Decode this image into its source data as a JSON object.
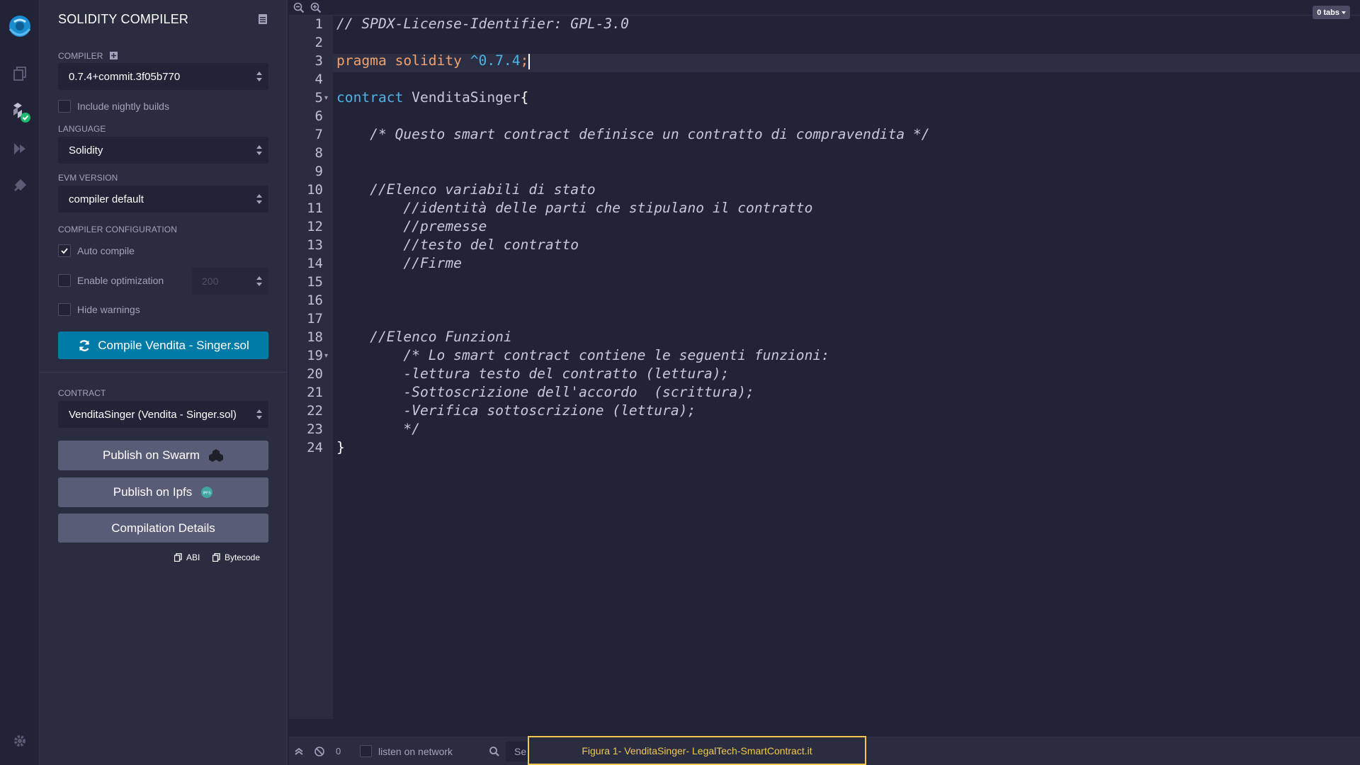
{
  "sidebar_icons": [
    "remix-logo-icon",
    "file-explorer-icon",
    "solidity-compiler-icon",
    "deploy-run-icon",
    "plugin-manager-icon",
    "settings-gear-icon"
  ],
  "panel": {
    "title": "SOLIDITY COMPILER",
    "compiler_label": "COMPILER",
    "compiler_value": "0.7.4+commit.3f05b770",
    "nightly_label": "Include nightly builds",
    "language_label": "LANGUAGE",
    "language_value": "Solidity",
    "evm_label": "EVM VERSION",
    "evm_value": "compiler default",
    "config_label": "COMPILER CONFIGURATION",
    "auto_compile_label": "Auto compile",
    "auto_compile_checked": true,
    "optimization_label": "Enable optimization",
    "runs_value": "200",
    "hide_warnings_label": "Hide warnings",
    "compile_button": "Compile Vendita - Singer.sol",
    "contract_label": "CONTRACT",
    "contract_value": "VenditaSinger (Vendita - Singer.sol)",
    "publish_swarm": "Publish on Swarm",
    "publish_ipfs": "Publish on Ipfs",
    "compilation_details": "Compilation Details",
    "abi_label": "ABI",
    "bytecode_label": "Bytecode"
  },
  "editor": {
    "tabs_badge": "0 tabs",
    "lines": [
      "// SPDX-License-Identifier: GPL-3.0",
      "",
      "pragma solidity ^0.7.4;",
      "",
      "contract VenditaSinger{",
      "",
      "    /* Questo smart contract definisce un contratto di compravendita */",
      "",
      "",
      "    //Elenco variabili di stato",
      "        //identità delle parti che stipulano il contratto",
      "        //premesse",
      "        //testo del contratto",
      "        //Firme",
      "",
      "",
      "",
      "    //Elenco Funzioni",
      "        /* Lo smart contract contiene le seguenti funzioni:",
      "        -lettura testo del contratto (lettura);",
      "        -Sottoscrizione dell'accordo  (scrittura);",
      "        -Verifica sottoscrizione (lettura);",
      "        */",
      "}"
    ]
  },
  "terminal": {
    "count": "0",
    "listen_label": "listen on network",
    "search_placeholder": "Se"
  },
  "caption": "Figura 1- VenditaSinger- LegalTech-SmartContract.it",
  "colors": {
    "accent": "#007aa6",
    "caption_border": "#f2c94c",
    "success": "#1fb86f"
  }
}
